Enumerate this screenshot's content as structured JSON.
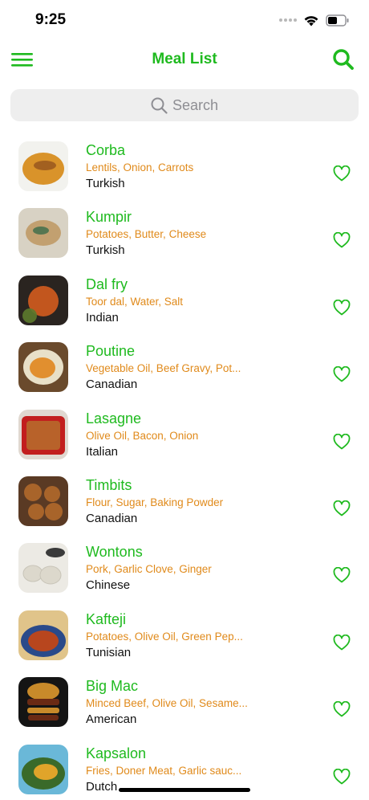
{
  "status_bar": {
    "time": "9:25",
    "signal_icon": "signal-dots-icon",
    "wifi_icon": "wifi-icon",
    "battery_icon": "battery-icon"
  },
  "nav": {
    "title": "Meal List",
    "menu_icon": "hamburger-menu-icon",
    "search_icon": "search-icon"
  },
  "search": {
    "placeholder": "Search"
  },
  "colors": {
    "accent": "#1fba1f",
    "ingredients": "#e08a1b",
    "search_bg": "#eeeeee"
  },
  "meals": [
    {
      "name": "Corba",
      "ingredients": "Lentils, Onion, Carrots",
      "cuisine": "Turkish",
      "thumb_colors": [
        "#f2f2ee",
        "#d9932a",
        "#8a4a1c"
      ]
    },
    {
      "name": "Kumpir",
      "ingredients": "Potatoes, Butter, Cheese",
      "cuisine": "Turkish",
      "thumb_colors": [
        "#d8d2c4",
        "#c2a070",
        "#3a6b4a"
      ]
    },
    {
      "name": "Dal fry",
      "ingredients": "Toor dal, Water, Salt",
      "cuisine": "Indian",
      "thumb_colors": [
        "#2a2420",
        "#c2561e",
        "#5c7a2c"
      ]
    },
    {
      "name": "Poutine",
      "ingredients": "Vegetable Oil, Beef Gravy, Pot...",
      "cuisine": "Canadian",
      "thumb_colors": [
        "#6a4a2c",
        "#e0861e",
        "#e8e0c8"
      ]
    },
    {
      "name": "Lasagne",
      "ingredients": "Olive Oil, Bacon, Onion",
      "cuisine": "Italian",
      "thumb_colors": [
        "#e0d8d0",
        "#b8622a",
        "#c21e1e"
      ]
    },
    {
      "name": "Timbits",
      "ingredients": "Flour, Sugar, Baking Powder",
      "cuisine": "Canadian",
      "thumb_colors": [
        "#5a3a24",
        "#a8642a",
        "#3a2418"
      ]
    },
    {
      "name": "Wontons",
      "ingredients": "Pork, Garlic Clove, Ginger",
      "cuisine": "Chinese",
      "thumb_colors": [
        "#eceae4",
        "#dcd8cc",
        "#3a3a3a"
      ]
    },
    {
      "name": "Kafteji",
      "ingredients": "Potatoes, Olive Oil, Green Pep...",
      "cuisine": "Tunisian",
      "thumb_colors": [
        "#2a4a8a",
        "#b8461e",
        "#e0c48a"
      ]
    },
    {
      "name": "Big Mac",
      "ingredients": "Minced Beef, Olive Oil, Sesame...",
      "cuisine": "American",
      "thumb_colors": [
        "#141414",
        "#c88a2a",
        "#6a2a14"
      ]
    },
    {
      "name": "Kapsalon",
      "ingredients": "Fries, Doner Meat, Garlic sauc...",
      "cuisine": "Dutch",
      "thumb_colors": [
        "#3a6a2a",
        "#e0a42a",
        "#6ab8d8"
      ]
    }
  ]
}
